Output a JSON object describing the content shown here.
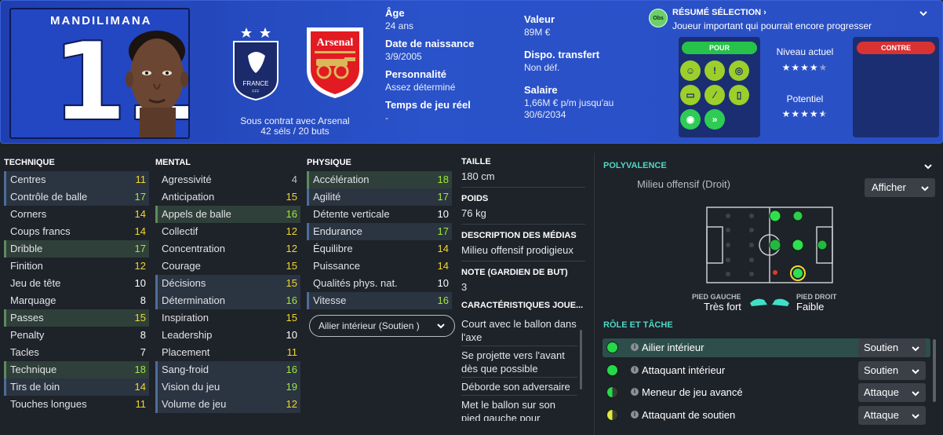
{
  "player": {
    "name": "MANDILIMANA",
    "number": "11",
    "contract": "Sous contrat avec Arsenal",
    "caps": "42 séls / 20 buts"
  },
  "info_left": [
    {
      "label": "Âge",
      "value": "24 ans"
    },
    {
      "label": "Date de naissance",
      "value": "3/9/2005"
    },
    {
      "label": "Personnalité",
      "value": "Assez déterminé"
    },
    {
      "label": "Temps de jeu réel",
      "value": "-"
    }
  ],
  "info_right": [
    {
      "label": "Valeur",
      "value": "89M €"
    },
    {
      "label": "Dispo. transfert",
      "value": "Non déf."
    },
    {
      "label": "Salaire",
      "value": "1,66M € p/m jusqu'au 30/6/2034"
    }
  ],
  "crests": {
    "france_text": "FRANCE",
    "fff_text": "FFF",
    "arsenal_text": "Arsenal"
  },
  "summary": {
    "badge": "Obs",
    "title": "RÉSUMÉ SÉLECTION",
    "text": "Joueur important qui pourrait encore progresser",
    "pour": "POUR",
    "contre": "CONTRE",
    "trait_icons": [
      "brain-icon",
      "flair-icon",
      "target-icon",
      "pitch-icon",
      "dribble-icon",
      "boots-icon",
      "vision-icon",
      "speed-icon"
    ],
    "current_level_label": "Niveau actuel",
    "current_level_stars": 4,
    "potential_label": "Potentiel",
    "potential_stars": 4.5
  },
  "technique": {
    "title": "TECHNIQUE",
    "rows": [
      {
        "name": "Centres",
        "value": "11"
      },
      {
        "name": "Contrôle de balle",
        "value": "17"
      },
      {
        "name": "Corners",
        "value": "14"
      },
      {
        "name": "Coups francs",
        "value": "14"
      },
      {
        "name": "Dribble",
        "value": "17"
      },
      {
        "name": "Finition",
        "value": "12"
      },
      {
        "name": "Jeu de tête",
        "value": "10"
      },
      {
        "name": "Marquage",
        "value": "8"
      },
      {
        "name": "Passes",
        "value": "15"
      },
      {
        "name": "Penalty",
        "value": "8"
      },
      {
        "name": "Tacles",
        "value": "7"
      },
      {
        "name": "Technique",
        "value": "18"
      },
      {
        "name": "Tirs de loin",
        "value": "14"
      },
      {
        "name": "Touches longues",
        "value": "11"
      }
    ]
  },
  "mental": {
    "title": "MENTAL",
    "rows": [
      {
        "name": "Agressivité",
        "value": "4"
      },
      {
        "name": "Anticipation",
        "value": "15"
      },
      {
        "name": "Appels de balle",
        "value": "16"
      },
      {
        "name": "Collectif",
        "value": "12"
      },
      {
        "name": "Concentration",
        "value": "12"
      },
      {
        "name": "Courage",
        "value": "15"
      },
      {
        "name": "Décisions",
        "value": "15"
      },
      {
        "name": "Détermination",
        "value": "16"
      },
      {
        "name": "Inspiration",
        "value": "15"
      },
      {
        "name": "Leadership",
        "value": "10"
      },
      {
        "name": "Placement",
        "value": "11"
      },
      {
        "name": "Sang-froid",
        "value": "16"
      },
      {
        "name": "Vision du jeu",
        "value": "19"
      },
      {
        "name": "Volume de jeu",
        "value": "12"
      }
    ]
  },
  "physique": {
    "title": "PHYSIQUE",
    "rows": [
      {
        "name": "Accélération",
        "value": "18"
      },
      {
        "name": "Agilité",
        "value": "17"
      },
      {
        "name": "Détente verticale",
        "value": "10"
      },
      {
        "name": "Endurance",
        "value": "17"
      },
      {
        "name": "Équilibre",
        "value": "14"
      },
      {
        "name": "Puissance",
        "value": "14"
      },
      {
        "name": "Qualités phys. nat.",
        "value": "10"
      },
      {
        "name": "Vitesse",
        "value": "16"
      }
    ],
    "role_select": "Ailier intérieur (Soutien )"
  },
  "details": {
    "height_label": "TAILLE",
    "height": "180 cm",
    "weight_label": "POIDS",
    "weight": "76 kg",
    "media_label": "DESCRIPTION DES MÉDIAS",
    "media": "Milieu offensif prodigieux",
    "gk_label": "NOTE (GARDIEN DE BUT)",
    "gk": "3",
    "traits_label": "CARACTÉRISTIQUES JOUE...",
    "traits": [
      "Court avec le ballon dans l'axe",
      "Se projette vers l'avant dès que possible",
      "Déborde son adversaire",
      "Met le ballon sur son pied gauche pour"
    ]
  },
  "polyvalence": {
    "title": "POLYVALENCE",
    "role": "Milieu offensif (Droit)",
    "show_button": "Afficher",
    "left_foot_label": "PIED GAUCHE",
    "left_foot": "Très fort",
    "right_foot_label": "PIED DROIT",
    "right_foot": "Faible"
  },
  "roles": {
    "title": "RÔLE ET TÂCHE",
    "items": [
      {
        "name": "Ailier intérieur",
        "duty": "Soutien"
      },
      {
        "name": "Attaquant intérieur",
        "duty": "Soutien"
      },
      {
        "name": "Meneur de jeu avancé",
        "duty": "Attaque"
      },
      {
        "name": "Attaquant de soutien",
        "duty": "Attaque"
      }
    ]
  },
  "colors": {
    "accent": "#4fd8c4",
    "header_blue": "#2a52c9",
    "good": "#9fe83a",
    "mid": "#f1d82a"
  }
}
